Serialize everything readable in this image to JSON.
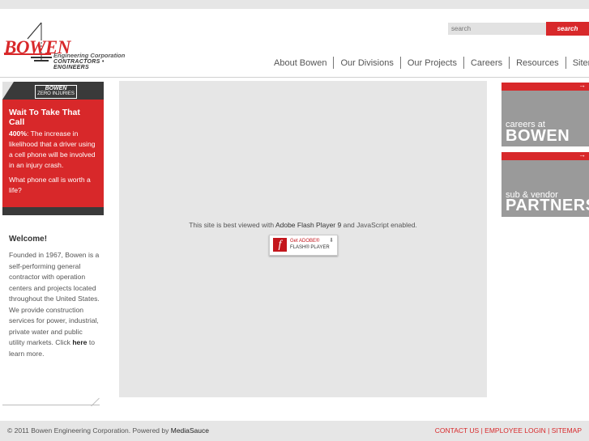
{
  "logo": {
    "brand": "BOWEN",
    "tagline1": "Engineering Corporation",
    "tagline2": "CONTRACTORS • ENGINEERS"
  },
  "search": {
    "placeholder": "search",
    "button_label": "search"
  },
  "nav": {
    "items": [
      "About Bowen",
      "Our Divisions",
      "Our Projects",
      "Careers",
      "Resources",
      "Sitemap"
    ]
  },
  "safety": {
    "badge_brand": "BOWEN",
    "badge_text": "ZERO INJURIES",
    "title": "Wait To Take That Call",
    "stat": "400%",
    "stat_text": ": The increase in likelihood that a driver using a cell phone will be involved in an injury crash.",
    "question": "What phone call is worth a life?"
  },
  "welcome": {
    "heading": "Welcome!",
    "text": "Founded in 1967, Bowen is a self-performing general contractor with operation centers and projects located throughout the United States.  We provide construction services for power, industrial, private water and public utility markets.  Click ",
    "link": "here",
    "text_end": " to learn more."
  },
  "flash": {
    "message_start": "This site is best viewed with ",
    "message_player": "Adobe Flash Player 9",
    "message_end": " and JavaScript enabled.",
    "badge_line1": "Get ADOBE®",
    "badge_line2": "FLASH® PLAYER",
    "icon": "f"
  },
  "banners": {
    "careers_small": "careers at",
    "careers_big": "BOWEN",
    "partners_small": "sub & vendor",
    "partners_big": "PARTNERS",
    "arrow": "→"
  },
  "footer": {
    "copyright": "© 2011 Bowen Engineering Corporation. Powered by ",
    "powered_by": "MediaSauce",
    "contact": "CONTACT US",
    "employee_login": "EMPLOYEE LOGIN",
    "sitemap": "SITEMAP",
    "separator": " | "
  },
  "colors": {
    "accent": "#d8282a",
    "dark": "#3a3a3a",
    "banner_gray": "#9a9a9a",
    "panel_gray": "#e6e6e6"
  }
}
